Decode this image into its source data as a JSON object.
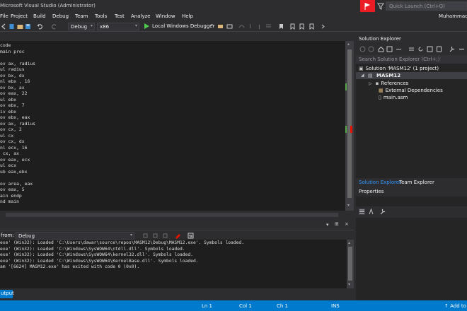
{
  "window": {
    "title": "Microsoft Visual Studio (Administrator)",
    "quick_launch_placeholder": "Quick Launch (Ctrl+Q)",
    "user": "Muhammad"
  },
  "menu": [
    "File",
    "Project",
    "Build",
    "Debug",
    "Team",
    "Tools",
    "Test",
    "Analyze",
    "Window",
    "Help"
  ],
  "toolbar": {
    "config": "Debug",
    "platform": "x86",
    "run_label": "Local Windows Debugger"
  },
  "editor": {
    "lines": [
      "code",
      "main proc",
      "",
      "ov ax, radius",
      "ul radius",
      "ov bx, dx",
      "nl ebx , 16",
      "ov bx, ax",
      "ov eax, 22",
      "ul ebx",
      "ov ebx, 7",
      "iv ebx",
      "ov ebx, eax",
      "ov ax, radius",
      "ov cx, 2",
      "ul cx",
      "ov cx, dx",
      "nl ecx, 16",
      " cx, ax",
      "ov eax, ecx",
      "ul ecx",
      "ub eax,ebx",
      "",
      "ov area, eax",
      "ov eax, 5",
      "ain endp",
      "nd main"
    ]
  },
  "output": {
    "show_from_label": "from:",
    "source": "Debug",
    "lines": [
      "exe' (Win32): Loaded 'C:\\Users\\dawar\\source\\repos\\MASM12\\Debug\\MASM12.exe'. Symbols loaded.",
      "exe' (Win32): Loaded 'C:\\Windows\\SysWOW64\\ntdll.dll'. Symbols loaded.",
      "exe' (Win32): Loaded 'C:\\Windows\\SysWOW64\\kernel32.dll'. Symbols loaded.",
      "exe' (Win32): Loaded 'C:\\Windows\\SysWOW64\\KernelBase.dll'. Symbols loaded.",
      "am '[6624] MASM12.exe' has exited with code 0 (0x0)."
    ],
    "tab_label": "utput"
  },
  "solution_explorer": {
    "title": "Solution Explorer",
    "search_placeholder": "Search Solution Explorer (Ctrl+;)",
    "solution_label": "Solution 'MASM12' (1 project)",
    "project_label": "MASM12",
    "items": [
      "References",
      "External Dependencies",
      "main.asm"
    ],
    "tab_active": "Solution Explorer",
    "tab_other": "Team Explorer"
  },
  "properties": {
    "title": "Properties"
  },
  "statusbar": {
    "ln": "Ln 1",
    "col": "Col 1",
    "ch": "Ch 1",
    "mode": "INS",
    "add_to": "Add to"
  },
  "colors": {
    "accent": "#007acc",
    "vs_flag": "#ec1c24",
    "editor_bg": "#1e1e1e",
    "chrome_bg": "#2d2d30"
  }
}
